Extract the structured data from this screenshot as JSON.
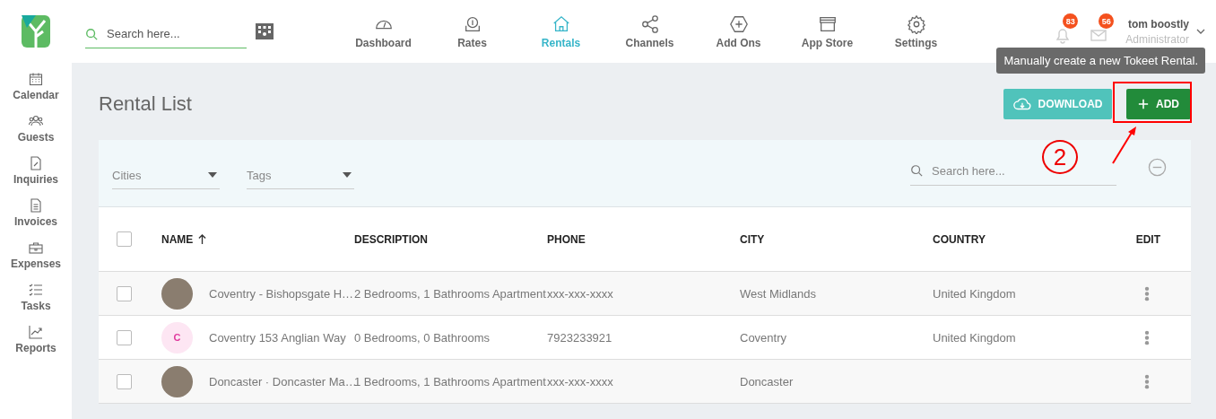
{
  "header": {
    "search": {
      "placeholder": "Search here..."
    },
    "nav": [
      {
        "label": "Dashboard",
        "selected": false
      },
      {
        "label": "Rates",
        "selected": false
      },
      {
        "label": "Rentals",
        "selected": true
      },
      {
        "label": "Channels",
        "selected": false
      },
      {
        "label": "Add Ons",
        "selected": false
      },
      {
        "label": "App Store",
        "selected": false
      },
      {
        "label": "Settings",
        "selected": false
      }
    ],
    "notifications": "83",
    "messages": "56",
    "user": {
      "name": "tom boostly",
      "role": "Administrator"
    }
  },
  "tooltip": "Manually create a new Tokeet Rental.",
  "sidebar": {
    "items": [
      {
        "label": "Calendar"
      },
      {
        "label": "Guests"
      },
      {
        "label": "Inquiries"
      },
      {
        "label": "Invoices"
      },
      {
        "label": "Expenses"
      },
      {
        "label": "Tasks"
      },
      {
        "label": "Reports"
      }
    ]
  },
  "page": {
    "title": "Rental List",
    "buttons": [
      {
        "label": "DOWNLOAD",
        "kind": "download"
      },
      {
        "label": "ADD",
        "kind": "add"
      }
    ]
  },
  "filters": {
    "cities": {
      "placeholder": "Cities"
    },
    "tags": {
      "placeholder": "Tags"
    },
    "search": {
      "placeholder": "Search here..."
    }
  },
  "annotation": {
    "step": "2"
  },
  "table": {
    "all_checked": false,
    "columns": [
      "NAME",
      "DESCRIPTION",
      "PHONE",
      "CITY",
      "COUNTRY",
      "EDIT"
    ],
    "rows": [
      {
        "checked": false,
        "avatar": {
          "kind": "photo"
        },
        "name": "Coventry - Bishopsgate H…",
        "description": "2 Bedrooms, 1 Bathrooms Apartment",
        "phone": "xxx-xxx-xxxx",
        "city": "West Midlands",
        "country": "United Kingdom"
      },
      {
        "checked": false,
        "avatar": {
          "kind": "letter",
          "letter": "C"
        },
        "name": "Coventry 153 Anglian Way",
        "description": "0 Bedrooms, 0 Bathrooms",
        "phone": "7923233921",
        "city": "Coventry",
        "country": "United Kingdom"
      },
      {
        "checked": false,
        "avatar": {
          "kind": "photo"
        },
        "name": "Doncaster · Doncaster Ma…",
        "description": "1 Bedrooms, 1 Bathrooms Apartment",
        "phone": "xxx-xxx-xxxx",
        "city": "Doncaster"
      }
    ]
  }
}
